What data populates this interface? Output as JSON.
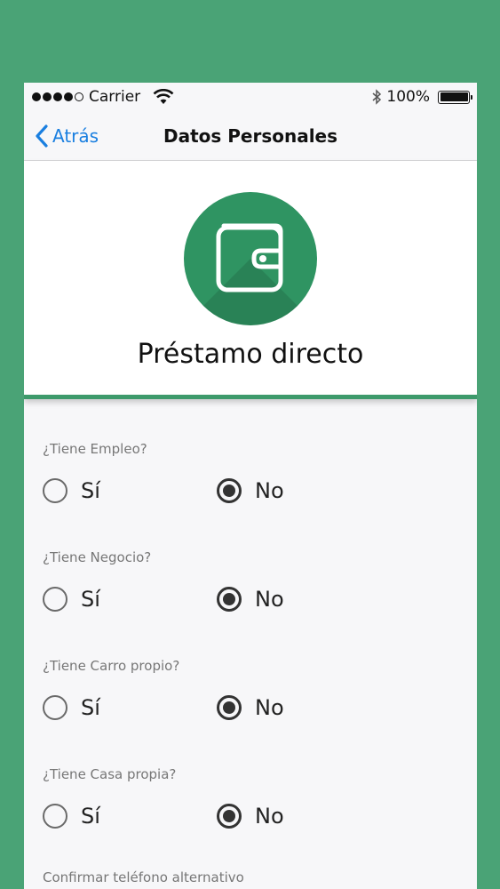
{
  "status_bar": {
    "carrier": "Carrier",
    "battery": "100%"
  },
  "nav": {
    "back_label": "Atrás",
    "title": "Datos Personales"
  },
  "hero": {
    "title": "Préstamo directo",
    "icon": "wallet-icon",
    "circle_color": "#2f9462"
  },
  "form": {
    "questions": [
      {
        "label": "¿Tiene Empleo?",
        "options": [
          "Sí",
          "No"
        ],
        "selected": "No"
      },
      {
        "label": "¿Tiene Negocio?",
        "options": [
          "Sí",
          "No"
        ],
        "selected": "No"
      },
      {
        "label": "¿Tiene Carro propio?",
        "options": [
          "Sí",
          "No"
        ],
        "selected": "No"
      },
      {
        "label": "¿Tiene Casa propia?",
        "options": [
          "Sí",
          "No"
        ],
        "selected": "No"
      }
    ],
    "confirm_phone_label": "Confirmar teléfono alternativo"
  },
  "colors": {
    "background": "#4aa376",
    "accent": "#1a7fe0",
    "brand": "#3d9a6b"
  }
}
